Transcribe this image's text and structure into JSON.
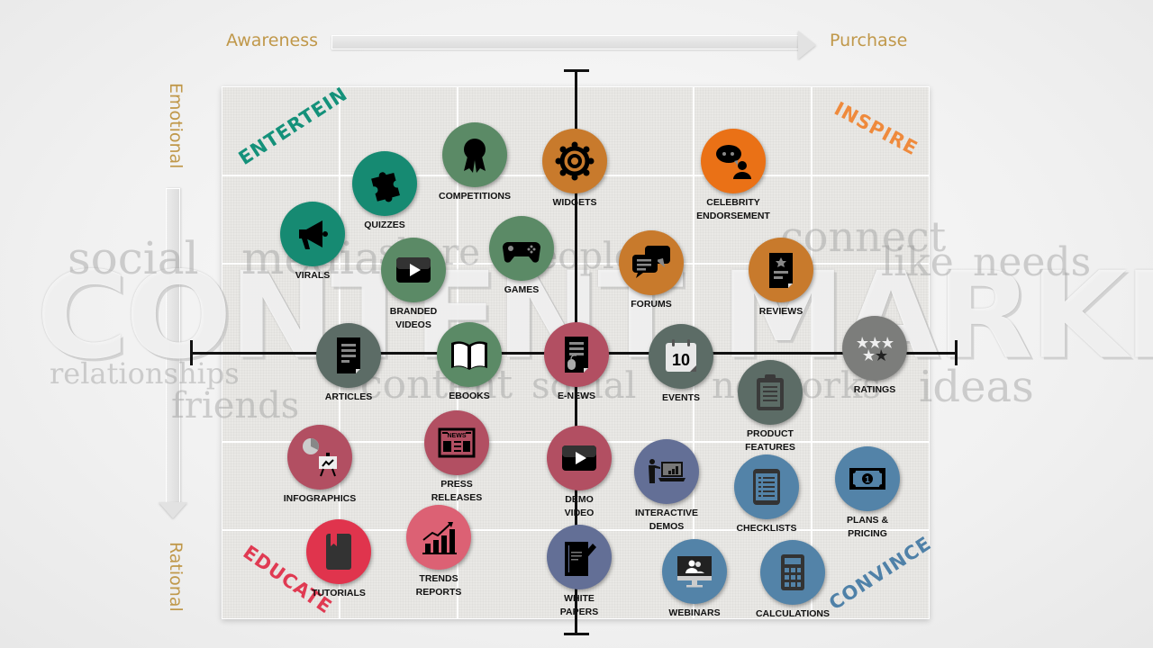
{
  "header": {
    "start_label": "Awareness",
    "end_label": "Purchase"
  },
  "side": {
    "top_label": "Emotional",
    "bottom_label": "Rational"
  },
  "watermark": {
    "title": "CONTENT MARKETING",
    "words": [
      "social",
      "media",
      "share",
      "people",
      "connect",
      "like",
      "needs",
      "relationships",
      "friends",
      "content",
      "social",
      "networks",
      "ideas"
    ]
  },
  "quadrants": {
    "top_left": {
      "label": "ENTERTEIN",
      "color": "#14917a"
    },
    "top_right": {
      "label": "INSPIRE",
      "color": "#ef8a3c"
    },
    "bottom_left": {
      "label": "EDUCATE",
      "color": "#e03a52"
    },
    "bottom_right": {
      "label": "CONVINCE",
      "color": "#4f81a8"
    }
  },
  "colors": {
    "teal": "#168a72",
    "green": "#5b8a66",
    "orange_bright": "#ea7116",
    "orange_dark": "#c87a2c",
    "slate": "#5c6c66",
    "grey": "#7c7d7b",
    "rose": "#b24f62",
    "red": "#e0344d",
    "pink": "#dc6174",
    "indigo": "#636f96",
    "steel": "#5383a8",
    "axis_label": "#c0984a"
  },
  "items": [
    {
      "id": "virals",
      "lines": [
        "VIRALS"
      ],
      "icon": "megaphone-icon",
      "color": "#168a72"
    },
    {
      "id": "quizzes",
      "lines": [
        "QUIZZES"
      ],
      "icon": "puzzle-icon",
      "color": "#168a72"
    },
    {
      "id": "competitions",
      "lines": [
        "COMPETITIONS"
      ],
      "icon": "award-ribbon-icon",
      "color": "#5b8a66"
    },
    {
      "id": "widgets",
      "lines": [
        "WIDGETS"
      ],
      "icon": "gear-icon",
      "color": "#c87a2c"
    },
    {
      "id": "celebrity",
      "lines": [
        "CELEBRITY",
        "ENDORSEMENT"
      ],
      "icon": "speech-person-icon",
      "color": "#ea7116"
    },
    {
      "id": "branded-videos",
      "lines": [
        "BRANDED",
        "VIDEOS"
      ],
      "icon": "video-play-icon",
      "color": "#5b8a66"
    },
    {
      "id": "games",
      "lines": [
        "GAMES"
      ],
      "icon": "gamepad-icon",
      "color": "#5b8a66"
    },
    {
      "id": "forums",
      "lines": [
        "FORUMS"
      ],
      "icon": "chat-bubbles-icon",
      "color": "#c87a2c"
    },
    {
      "id": "reviews",
      "lines": [
        "REVIEWS"
      ],
      "icon": "review-doc-icon",
      "color": "#c87a2c"
    },
    {
      "id": "articles",
      "lines": [
        "ARTICLES"
      ],
      "icon": "document-icon",
      "color": "#5c6c66"
    },
    {
      "id": "ebooks",
      "lines": [
        "EBOOKS"
      ],
      "icon": "open-book-icon",
      "color": "#5b8a66"
    },
    {
      "id": "e-news",
      "lines": [
        "E-NEWS"
      ],
      "icon": "newsletter-mouse-icon",
      "color": "#b24f62"
    },
    {
      "id": "events",
      "lines": [
        "EVENTS"
      ],
      "icon": "calendar-icon",
      "calendar_day": "10",
      "color": "#5c6c66"
    },
    {
      "id": "ratings",
      "lines": [
        "RATINGS"
      ],
      "icon": "stars-icon",
      "stars_filled": 4,
      "stars_total": 5,
      "color": "#7c7d7b"
    },
    {
      "id": "product-features",
      "lines": [
        "PRODUCT",
        "FEATURES"
      ],
      "icon": "clipboard-icon",
      "color": "#5c6c66"
    },
    {
      "id": "infographics",
      "lines": [
        "INFOGRAPHICS"
      ],
      "icon": "pie-easel-icon",
      "color": "#b24f62"
    },
    {
      "id": "press-releases",
      "lines": [
        "PRESS",
        "RELEASES"
      ],
      "icon": "newspaper-icon",
      "newspaper_text": "NEWS",
      "color": "#b24f62"
    },
    {
      "id": "demo-video",
      "lines": [
        "DEMO",
        "VIDEO"
      ],
      "icon": "video-play-icon",
      "color": "#b24f62"
    },
    {
      "id": "interactive-demos",
      "lines": [
        "INTERACTIVE",
        "DEMOS"
      ],
      "icon": "presenter-laptop-icon",
      "color": "#636f96"
    },
    {
      "id": "checklists",
      "lines": [
        "CHECKLISTS"
      ],
      "icon": "checklist-tablet-icon",
      "color": "#5383a8"
    },
    {
      "id": "plans-pricing",
      "lines": [
        "PLANS &",
        "PRICING"
      ],
      "icon": "banknote-icon",
      "color": "#5383a8"
    },
    {
      "id": "tutorials",
      "lines": [
        "TUTORIALS"
      ],
      "icon": "bookmark-book-icon",
      "color": "#e0344d"
    },
    {
      "id": "trends-reports",
      "lines": [
        "TRENDS",
        "REPORTS"
      ],
      "icon": "growth-chart-icon",
      "color": "#dc6174"
    },
    {
      "id": "white-papers",
      "lines": [
        "WHITE",
        "PAPERS"
      ],
      "icon": "paper-pen-icon",
      "color": "#636f96"
    },
    {
      "id": "webinars",
      "lines": [
        "WEBINARS"
      ],
      "icon": "monitor-people-icon",
      "color": "#5383a8"
    },
    {
      "id": "calculations",
      "lines": [
        "CALCULATIONS"
      ],
      "icon": "calculator-icon",
      "color": "#5383a8"
    }
  ]
}
